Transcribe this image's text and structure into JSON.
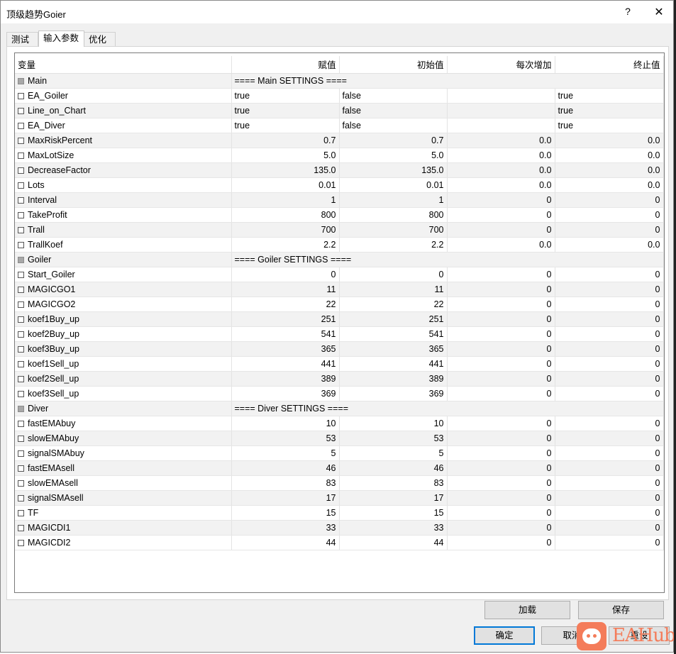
{
  "window": {
    "title": "顶级趋势Goier",
    "help_glyph": "?",
    "close_glyph": "✕"
  },
  "tabs": [
    {
      "label": "测试",
      "active": false
    },
    {
      "label": "输入参数",
      "active": true
    },
    {
      "label": "优化",
      "active": false
    }
  ],
  "table": {
    "columns": [
      "变量",
      "赋值",
      "初始值",
      "每次增加",
      "终止值"
    ],
    "rows": [
      {
        "kind": "section",
        "name": "Main",
        "title": "==== Main SETTINGS ===="
      },
      {
        "kind": "bool",
        "name": "EA_Goiler",
        "value": "true",
        "start": "false",
        "step": "",
        "stop": "true"
      },
      {
        "kind": "bool",
        "name": "Line_on_Chart",
        "value": "true",
        "start": "false",
        "step": "",
        "stop": "true"
      },
      {
        "kind": "bool",
        "name": "EA_Diver",
        "value": "true",
        "start": "false",
        "step": "",
        "stop": "true"
      },
      {
        "kind": "num",
        "name": "MaxRiskPercent",
        "value": "0.7",
        "start": "0.7",
        "step": "0.0",
        "stop": "0.0"
      },
      {
        "kind": "num",
        "name": "MaxLotSize",
        "value": "5.0",
        "start": "5.0",
        "step": "0.0",
        "stop": "0.0"
      },
      {
        "kind": "num",
        "name": "DecreaseFactor",
        "value": "135.0",
        "start": "135.0",
        "step": "0.0",
        "stop": "0.0"
      },
      {
        "kind": "num",
        "name": "Lots",
        "value": "0.01",
        "start": "0.01",
        "step": "0.0",
        "stop": "0.0"
      },
      {
        "kind": "num",
        "name": "Interval",
        "value": "1",
        "start": "1",
        "step": "0",
        "stop": "0"
      },
      {
        "kind": "num",
        "name": "TakeProfit",
        "value": "800",
        "start": "800",
        "step": "0",
        "stop": "0"
      },
      {
        "kind": "num",
        "name": "Trall",
        "value": "700",
        "start": "700",
        "step": "0",
        "stop": "0"
      },
      {
        "kind": "num",
        "name": "TrallKoef",
        "value": "2.2",
        "start": "2.2",
        "step": "0.0",
        "stop": "0.0"
      },
      {
        "kind": "section",
        "name": "Goiler",
        "title": "==== Goiler SETTINGS  ===="
      },
      {
        "kind": "num",
        "name": "Start_Goiler",
        "value": "0",
        "start": "0",
        "step": "0",
        "stop": "0"
      },
      {
        "kind": "num",
        "name": "MAGICGO1",
        "value": "11",
        "start": "11",
        "step": "0",
        "stop": "0"
      },
      {
        "kind": "num",
        "name": "MAGICGO2",
        "value": "22",
        "start": "22",
        "step": "0",
        "stop": "0"
      },
      {
        "kind": "num",
        "name": "koef1Buy_up",
        "value": "251",
        "start": "251",
        "step": "0",
        "stop": "0"
      },
      {
        "kind": "num",
        "name": "koef2Buy_up",
        "value": "541",
        "start": "541",
        "step": "0",
        "stop": "0"
      },
      {
        "kind": "num",
        "name": "koef3Buy_up",
        "value": "365",
        "start": "365",
        "step": "0",
        "stop": "0"
      },
      {
        "kind": "num",
        "name": "koef1Sell_up",
        "value": "441",
        "start": "441",
        "step": "0",
        "stop": "0"
      },
      {
        "kind": "num",
        "name": "koef2Sell_up",
        "value": "389",
        "start": "389",
        "step": "0",
        "stop": "0"
      },
      {
        "kind": "num",
        "name": "koef3Sell_up",
        "value": "369",
        "start": "369",
        "step": "0",
        "stop": "0"
      },
      {
        "kind": "section",
        "name": "Diver",
        "title": "==== Diver SETTINGS ===="
      },
      {
        "kind": "num",
        "name": "fastEMAbuy",
        "value": "10",
        "start": "10",
        "step": "0",
        "stop": "0"
      },
      {
        "kind": "num",
        "name": "slowEMAbuy",
        "value": "53",
        "start": "53",
        "step": "0",
        "stop": "0"
      },
      {
        "kind": "num",
        "name": "signalSMAbuy",
        "value": "5",
        "start": "5",
        "step": "0",
        "stop": "0"
      },
      {
        "kind": "num",
        "name": "fastEMAsell",
        "value": "46",
        "start": "46",
        "step": "0",
        "stop": "0"
      },
      {
        "kind": "num",
        "name": "slowEMAsell",
        "value": "83",
        "start": "83",
        "step": "0",
        "stop": "0"
      },
      {
        "kind": "num",
        "name": "signalSMAsell",
        "value": "17",
        "start": "17",
        "step": "0",
        "stop": "0"
      },
      {
        "kind": "num",
        "name": "TF",
        "value": "15",
        "start": "15",
        "step": "0",
        "stop": "0"
      },
      {
        "kind": "num",
        "name": "MAGICDI1",
        "value": "33",
        "start": "33",
        "step": "0",
        "stop": "0"
      },
      {
        "kind": "num",
        "name": "MAGICDI2",
        "value": "44",
        "start": "44",
        "step": "0",
        "stop": "0"
      }
    ]
  },
  "buttons": {
    "load": "加载",
    "save": "保存",
    "ok": "确定",
    "cancel": "取消",
    "reset": "重设"
  },
  "watermark": {
    "text": "EAHub",
    "brand_color": "#f47c5a"
  }
}
